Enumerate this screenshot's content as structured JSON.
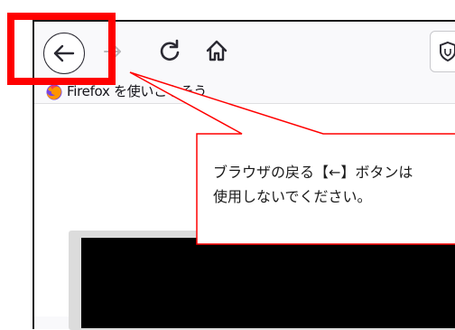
{
  "bookmarks_bar": {
    "item_label": "Firefox を使いこなそう"
  },
  "callout": {
    "line1": "ブラウザの戻る【←】ボタンは",
    "line2": "使用しないでください。"
  },
  "colors": {
    "highlight": "#ff0000",
    "callout_fill": "#ffffff",
    "content_dark": "#000000"
  },
  "icons": [
    "back-arrow-icon",
    "forward-arrow-icon",
    "reload-icon",
    "home-icon",
    "shield-icon",
    "firefox-logo-icon"
  ]
}
